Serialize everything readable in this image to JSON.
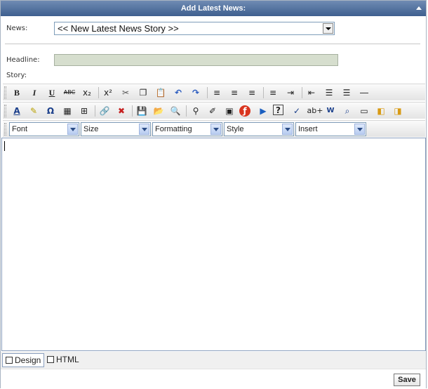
{
  "panel": {
    "title": "Add Latest News:"
  },
  "form": {
    "news_label": "News:",
    "news_value": "<< New Latest News Story >>",
    "headline_label": "Headline:",
    "headline_value": "",
    "story_label": "Story:"
  },
  "toolbar1": [
    {
      "name": "bold-icon",
      "glyph": "B"
    },
    {
      "name": "italic-icon",
      "glyph": "I"
    },
    {
      "name": "underline-icon",
      "glyph": "U"
    },
    {
      "name": "strikethrough-icon",
      "glyph": "ABC"
    },
    {
      "name": "subscript-icon",
      "glyph": "x₂"
    },
    {
      "name": "superscript-icon",
      "glyph": "x²"
    },
    {
      "name": "cut-icon",
      "glyph": "✂"
    },
    {
      "name": "copy-icon",
      "glyph": "❐"
    },
    {
      "name": "paste-icon",
      "glyph": "📋"
    },
    {
      "name": "undo-icon",
      "glyph": "↶"
    },
    {
      "name": "redo-icon",
      "glyph": "↷"
    },
    {
      "name": "align-left-icon",
      "glyph": "≡"
    },
    {
      "name": "align-center-icon",
      "glyph": "≡"
    },
    {
      "name": "align-right-icon",
      "glyph": "≡"
    },
    {
      "name": "justify-icon",
      "glyph": "≡"
    },
    {
      "name": "indent-icon",
      "glyph": "⇥"
    },
    {
      "name": "outdent-icon",
      "glyph": "⇤"
    },
    {
      "name": "bulleted-list-icon",
      "glyph": "☰"
    },
    {
      "name": "numbered-list-icon",
      "glyph": "☰"
    },
    {
      "name": "horizontal-rule-icon",
      "glyph": "―"
    }
  ],
  "toolbar2": [
    {
      "name": "font-color-icon",
      "glyph": "A"
    },
    {
      "name": "highlight-color-icon",
      "glyph": "✎"
    },
    {
      "name": "symbol-icon",
      "glyph": "Ω"
    },
    {
      "name": "insert-table-icon",
      "glyph": "▦"
    },
    {
      "name": "table-borders-icon",
      "glyph": "⊞"
    },
    {
      "name": "hyperlink-icon",
      "glyph": "🔗"
    },
    {
      "name": "remove-link-icon",
      "glyph": "✖"
    },
    {
      "name": "save-icon",
      "glyph": "💾"
    },
    {
      "name": "open-icon",
      "glyph": "📂"
    },
    {
      "name": "preview-icon",
      "glyph": "🔍"
    },
    {
      "name": "find-icon",
      "glyph": "⚲"
    },
    {
      "name": "format-painter-icon",
      "glyph": "✐"
    },
    {
      "name": "insert-image-icon",
      "glyph": "▣"
    },
    {
      "name": "insert-flash-icon",
      "glyph": "ƒ"
    },
    {
      "name": "insert-media-icon",
      "glyph": "▶"
    },
    {
      "name": "help-icon",
      "glyph": "?"
    },
    {
      "name": "spellcheck-icon",
      "glyph": "✓"
    },
    {
      "name": "find-replace-icon",
      "glyph": "ab+"
    },
    {
      "name": "paste-from-word-icon",
      "glyph": "W"
    },
    {
      "name": "zoom-icon",
      "glyph": "⌕"
    },
    {
      "name": "insert-form-icon",
      "glyph": "▭"
    },
    {
      "name": "bring-forward-icon",
      "glyph": "◧"
    },
    {
      "name": "send-backward-icon",
      "glyph": "◨"
    }
  ],
  "toolbar3": {
    "font": "Font",
    "size": "Size",
    "formatting": "Formatting",
    "style": "Style",
    "insert": "Insert"
  },
  "editor": {
    "content": ""
  },
  "modes": {
    "design": "Design",
    "html": "HTML"
  },
  "actions": {
    "save": "Save"
  }
}
